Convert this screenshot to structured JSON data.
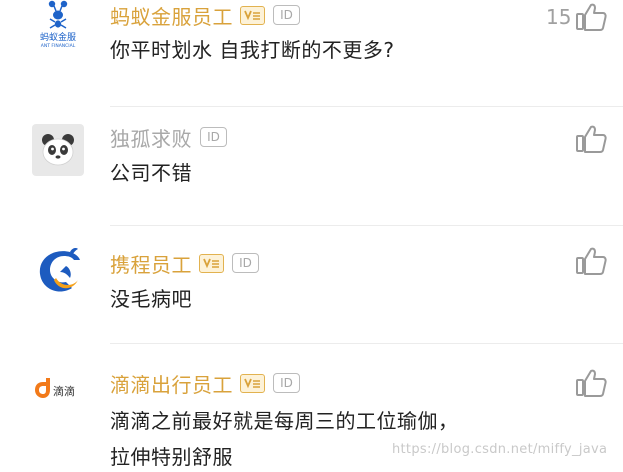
{
  "comments": [
    {
      "author": "蚂蚁金服员工",
      "avatar_icon": "ant-financial-logo-icon",
      "avatar_text": "蚂蚁金服",
      "avatar_subtext": "ANT FINANCIAL",
      "verified": true,
      "id_badge": "ID",
      "text": [
        "你平时划水 自我打断的不更多?"
      ],
      "likes": "15"
    },
    {
      "author": "独孤求败",
      "avatar_icon": "panda-avatar-icon",
      "verified": false,
      "id_badge": "ID",
      "text": [
        "公司不错"
      ],
      "likes": ""
    },
    {
      "author": "携程员工",
      "avatar_icon": "ctrip-dolphin-logo-icon",
      "verified": true,
      "id_badge": "ID",
      "text": [
        "没毛病吧"
      ],
      "likes": ""
    },
    {
      "author": "滴滴出行员工",
      "avatar_icon": "didi-logo-icon",
      "avatar_text": "滴滴",
      "verified": true,
      "id_badge": "ID",
      "text": [
        "滴滴之前最好就是每周三的工位瑜伽，",
        "拉伸特别舒服"
      ],
      "likes": ""
    }
  ],
  "watermark": "https://blog.csdn.net/miffy_java",
  "colors": {
    "employee_name": "#d9a23b",
    "plain_name": "#a8a8a8",
    "body_text": "#222222",
    "icon_gray": "#9a9a9a"
  }
}
